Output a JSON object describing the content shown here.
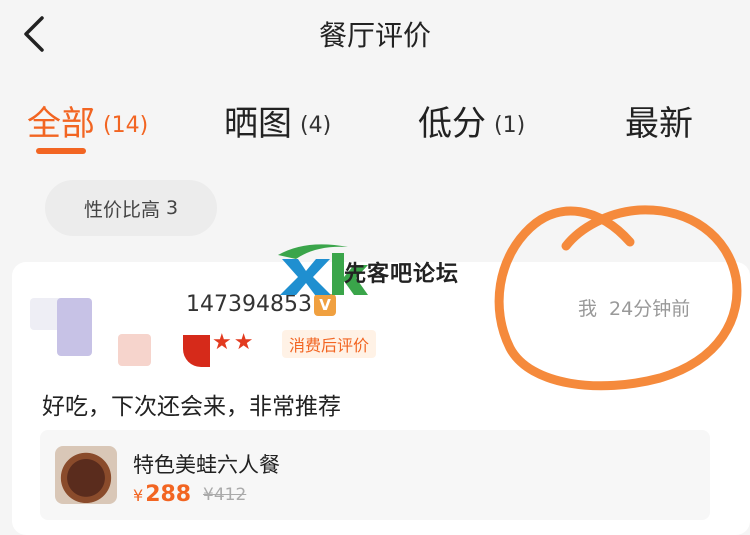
{
  "header": {
    "title": "餐厅评价"
  },
  "tabs": [
    {
      "label": "全部",
      "count": "(14)",
      "active": true
    },
    {
      "label": "晒图",
      "count": "(4)"
    },
    {
      "label": "低分",
      "count": "(1)"
    },
    {
      "label": "最新",
      "count": ""
    }
  ],
  "filter_tags": [
    {
      "label": "性价比高",
      "count": "3"
    }
  ],
  "review": {
    "username": "147394853",
    "vip_badge": "V",
    "stars": "★★",
    "badge": "消费后评价",
    "me_label": "我",
    "time": "24分钟前",
    "text": "好吃，下次还会来，非常推荐",
    "dish": {
      "name": "特色美蛙六人餐",
      "currency": "¥",
      "price": "288",
      "original_price": "¥412"
    }
  },
  "watermark": {
    "text": "先客吧论坛"
  },
  "colors": {
    "accent": "#f26522",
    "star": "#e23a1f",
    "annotation": "#f58a3c",
    "watermark_green": "#3aa54a",
    "watermark_blue": "#1f8fd0"
  },
  "icons": {
    "back": "chevron-left-icon"
  }
}
